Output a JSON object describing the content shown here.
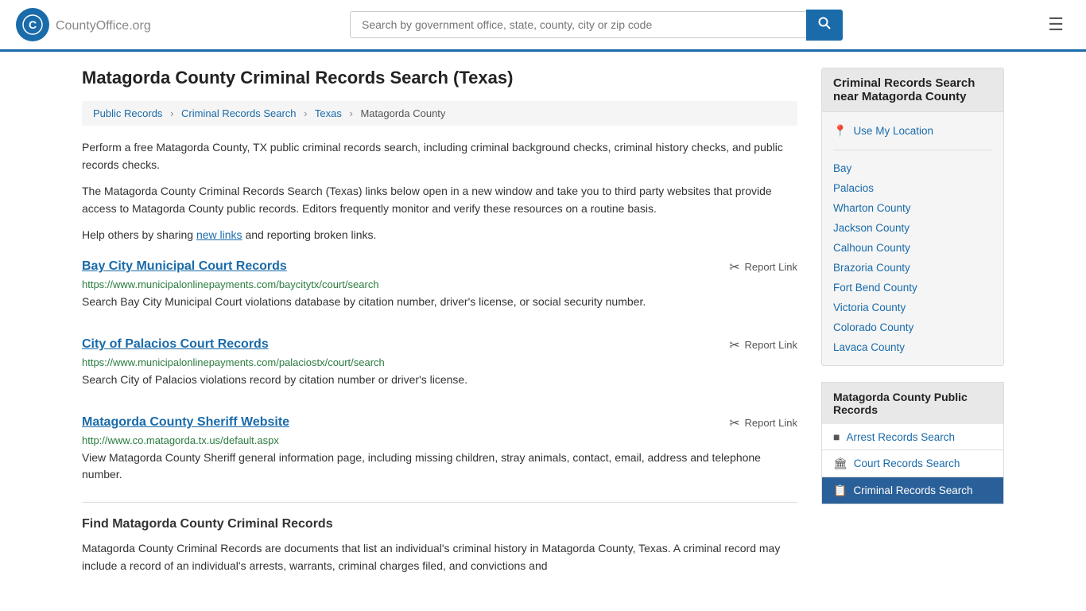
{
  "header": {
    "logo_text": "CountyOffice",
    "logo_suffix": ".org",
    "search_placeholder": "Search by government office, state, county, city or zip code",
    "search_value": ""
  },
  "page": {
    "title": "Matagorda County Criminal Records Search (Texas)",
    "breadcrumb": [
      {
        "label": "Public Records",
        "url": "#"
      },
      {
        "label": "Criminal Records Search",
        "url": "#"
      },
      {
        "label": "Texas",
        "url": "#"
      },
      {
        "label": "Matagorda County",
        "url": "#"
      }
    ],
    "description1": "Perform a free Matagorda County, TX public criminal records search, including criminal background checks, criminal history checks, and public records checks.",
    "description2": "The Matagorda County Criminal Records Search (Texas) links below open in a new window and take you to third party websites that provide access to Matagorda County public records. Editors frequently monitor and verify these resources on a routine basis.",
    "description3": "Help others by sharing",
    "new_links_text": "new links",
    "description3_end": "and reporting broken links."
  },
  "records": [
    {
      "title": "Bay City Municipal Court Records",
      "url": "https://www.municipalonlinepayments.com/baycitytx/court/search",
      "description": "Search Bay City Municipal Court violations database by citation number, driver's license, or social security number.",
      "report_label": "Report Link"
    },
    {
      "title": "City of Palacios Court Records",
      "url": "https://www.municipalonlinepayments.com/palaciostx/court/search",
      "description": "Search City of Palacios violations record by citation number or driver's license.",
      "report_label": "Report Link"
    },
    {
      "title": "Matagorda County Sheriff Website",
      "url": "http://www.co.matagorda.tx.us/default.aspx",
      "description": "View Matagorda County Sheriff general information page, including missing children, stray animals, contact, email, address and telephone number.",
      "report_label": "Report Link"
    }
  ],
  "find_section": {
    "title": "Find Matagorda County Criminal Records",
    "description": "Matagorda County Criminal Records are documents that list an individual's criminal history in Matagorda County, Texas. A criminal record may include a record of an individual's arrests, warrants, criminal charges filed, and convictions and"
  },
  "sidebar": {
    "nearby_title": "Criminal Records Search near Matagorda County",
    "use_location": "Use My Location",
    "nearby_items": [
      {
        "label": "Bay",
        "icon": "•"
      },
      {
        "label": "Palacios",
        "icon": "•"
      },
      {
        "label": "Wharton County",
        "icon": "•"
      },
      {
        "label": "Jackson County",
        "icon": "•"
      },
      {
        "label": "Calhoun County",
        "icon": "•"
      },
      {
        "label": "Brazoria County",
        "icon": "•"
      },
      {
        "label": "Fort Bend County",
        "icon": "•"
      },
      {
        "label": "Victoria County",
        "icon": "•"
      },
      {
        "label": "Colorado County",
        "icon": "•"
      },
      {
        "label": "Lavaca County",
        "icon": "•"
      }
    ],
    "public_records_title": "Matagorda County Public Records",
    "public_records_items": [
      {
        "label": "Arrest Records Search",
        "icon": "■",
        "active": false
      },
      {
        "label": "Court Records Search",
        "icon": "🏛",
        "active": false
      },
      {
        "label": "Criminal Records Search",
        "icon": "📋",
        "active": true
      }
    ]
  }
}
